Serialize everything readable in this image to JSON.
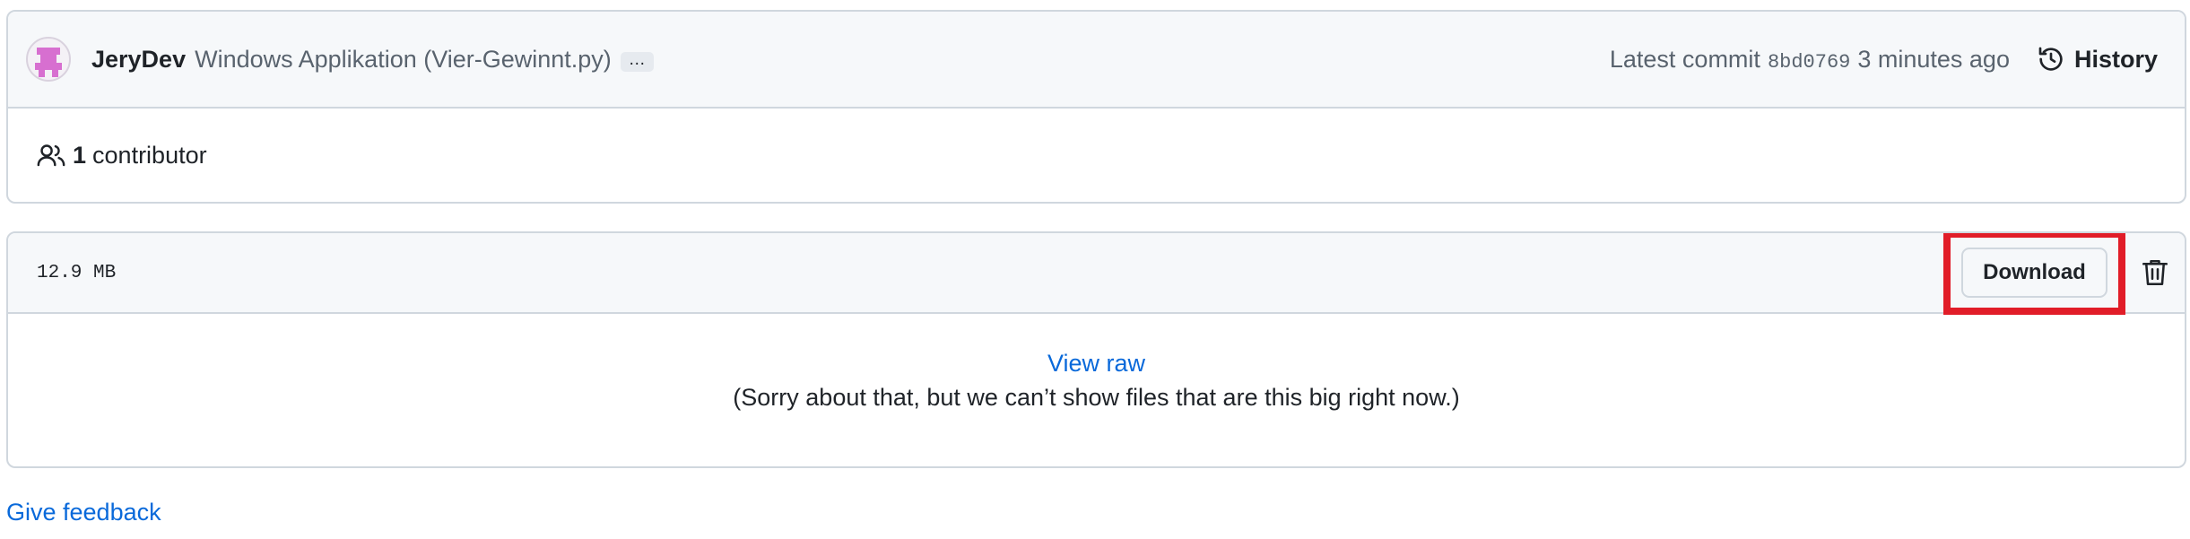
{
  "commit": {
    "author": "JeryDev",
    "message": "Windows Applikation (Vier-Gewinnt.py)",
    "more_label": "…",
    "latest_label": "Latest commit",
    "sha": "8bd0769",
    "time": "3 minutes ago",
    "history_label": "History"
  },
  "contributors": {
    "count": "1",
    "label": "contributor"
  },
  "file": {
    "size": "12.9 MB",
    "download_label": "Download",
    "view_raw_label": "View raw",
    "message": "(Sorry about that, but we can’t show files that are this big right now.)"
  },
  "footer": {
    "feedback_label": "Give feedback"
  },
  "icons": {
    "history": "history-icon",
    "people": "people-icon",
    "trash": "trash-icon"
  },
  "colors": {
    "link": "#0969da",
    "highlight": "#e11d28",
    "avatar_accent": "#d76fd0"
  }
}
